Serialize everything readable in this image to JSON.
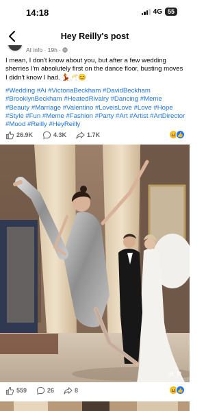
{
  "status": {
    "time": "14:18",
    "network": "4G",
    "battery": "55"
  },
  "header": {
    "title": "Hey Reilly's post"
  },
  "post": {
    "meta": "AI info · 19h · ",
    "text": "I mean, I don't know about you, but after a few wedding sherries I'm absolutely first on the dance floor, busting moves I didn't know I had. 💃🥂😊",
    "hashtags": "#Wedding #Ai #VictoriaBeckham #DavidBeckham #BrooklynBeckham #HeatedRivalry #Dancing #Meme #Beauty #Marriage #Valentino #LoveisLove #Love #Hope #Style #Fun #Meme #Fashion #Party #Art #Artist #ArtDirector #Mood #Reilly #HeyReilly",
    "actions": {
      "likes": "26.9K",
      "comments": "4.3K",
      "shares": "1.7K"
    }
  },
  "photo": {
    "watermark": "H_R"
  },
  "photo_actions": {
    "likes": "559",
    "comments": "26",
    "shares": "8"
  },
  "icons": {
    "back": "chevron-left-icon",
    "like": "thumbs-up-icon",
    "comment": "comment-bubble-icon",
    "share": "share-arrow-icon",
    "globe": "globe-icon"
  },
  "colors": {
    "link": "#1b74e4",
    "muted": "#65676b",
    "like_blue": "#1877f2",
    "haha_yellow": "#f7b928"
  }
}
